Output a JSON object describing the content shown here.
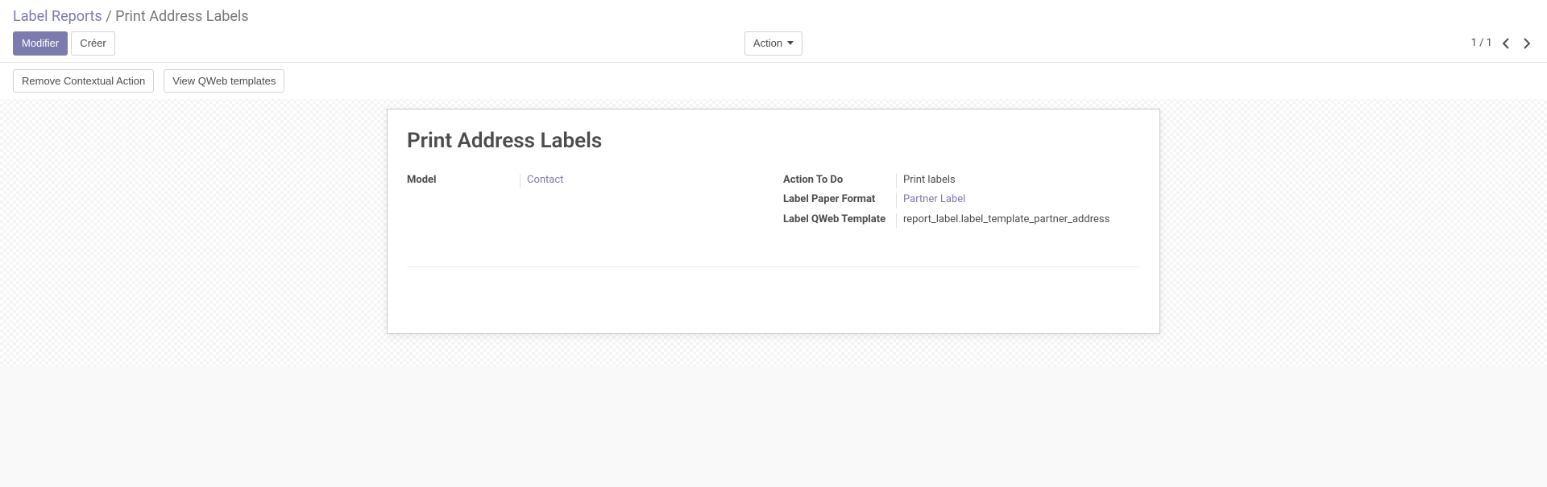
{
  "breadcrumb": {
    "parent": "Label Reports",
    "current": "Print Address Labels"
  },
  "toolbar": {
    "modifier_label": "Modifier",
    "creer_label": "Créer",
    "action_label": "Action"
  },
  "pager": {
    "text": "1 / 1"
  },
  "buttons": {
    "remove_contextual_action": "Remove Contextual Action",
    "view_qweb_templates": "View QWeb templates"
  },
  "sheet": {
    "title": "Print Address Labels",
    "left": {
      "model_label": "Model",
      "model_value": "Contact"
    },
    "right": {
      "action_to_do_label": "Action To Do",
      "action_to_do_value": "Print labels",
      "label_paper_format_label": "Label Paper Format",
      "label_paper_format_value": "Partner Label",
      "label_qweb_template_label": "Label QWeb Template",
      "label_qweb_template_value": "report_label.label_template_partner_address"
    }
  }
}
